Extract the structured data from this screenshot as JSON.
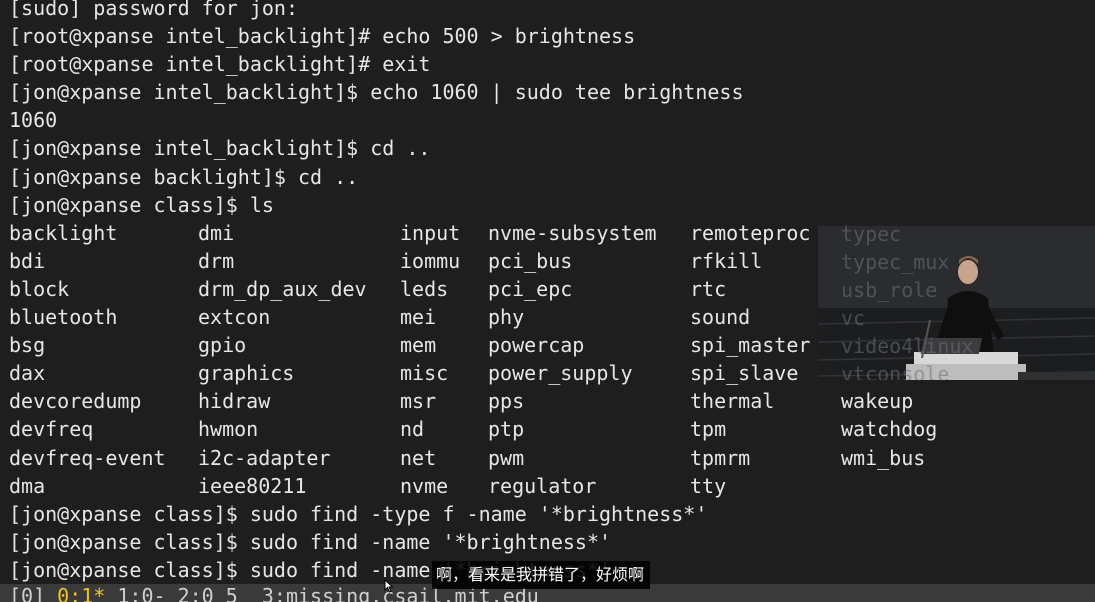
{
  "terminal": {
    "lines_before": [
      "[sudo] password for jon:",
      "[root@xpanse intel_backlight]# echo 500 > brightness",
      "[root@xpanse intel_backlight]# exit",
      "[jon@xpanse intel_backlight]$ echo 1060 | sudo tee brightness",
      "1060",
      "[jon@xpanse intel_backlight]$ cd ..",
      "[jon@xpanse backlight]$ cd ..",
      "[jon@xpanse class]$ ls"
    ],
    "ls_output": [
      [
        "backlight",
        "dmi",
        "input",
        "nvme-subsystem",
        "remoteproc",
        "typec"
      ],
      [
        "bdi",
        "drm",
        "iommu",
        "pci_bus",
        "rfkill",
        "typec_mux"
      ],
      [
        "block",
        "drm_dp_aux_dev",
        "leds",
        "pci_epc",
        "rtc",
        "usb_role"
      ],
      [
        "bluetooth",
        "extcon",
        "mei",
        "phy",
        "sound",
        "vc"
      ],
      [
        "bsg",
        "gpio",
        "mem",
        "powercap",
        "spi_master",
        "video4linux"
      ],
      [
        "dax",
        "graphics",
        "misc",
        "power_supply",
        "spi_slave",
        "vtconsole"
      ],
      [
        "devcoredump",
        "hidraw",
        "msr",
        "pps",
        "thermal",
        "wakeup"
      ],
      [
        "devfreq",
        "hwmon",
        "nd",
        "ptp",
        "tpm",
        "watchdog"
      ],
      [
        "devfreq-event",
        "i2c-adapter",
        "net",
        "pwm",
        "tpmrm",
        "wmi_bus"
      ],
      [
        "dma",
        "ieee80211",
        "nvme",
        "regulator",
        "tty",
        ""
      ]
    ],
    "lines_after": [
      "[jon@xpanse class]$ sudo find -type f -name '*brightness*'",
      "[jon@xpanse class]$ sudo find -name '*brightness*'",
      "[jon@xpanse class]$ sudo find -name '*brightness*'"
    ]
  },
  "status_bar": {
    "window_0": "[0] ",
    "window_1_active": "0:1*",
    "rest": " 1:0- 2:0 5  3:missing.csail.mit.edu"
  },
  "subtitle": {
    "text": "啊，看来是我拼错了，好烦啊"
  },
  "video_overlay": {
    "visible_text": [
      "typec",
      "typec_mux",
      "usb_role",
      "vc",
      "video4linux",
      "vtconsole"
    ]
  },
  "colors": {
    "terminal_bg": "#1e1e1e",
    "terminal_fg": "#e6e6e6",
    "status_bg": "#3a3a3a",
    "active_window": "#f0c419"
  },
  "icons": {
    "pointer": "mouse-pointer-icon"
  }
}
